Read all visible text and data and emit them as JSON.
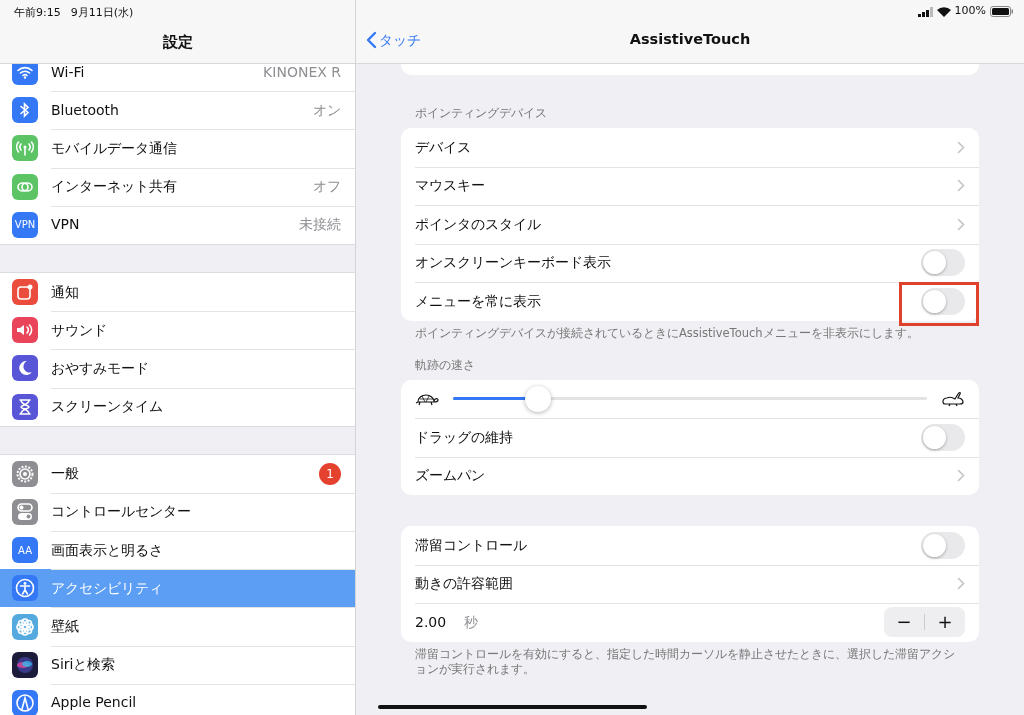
{
  "status_bar": {
    "time": "午前9:15",
    "date": "9月11日(水)",
    "battery": "100%"
  },
  "sidebar": {
    "title": "設定",
    "groups": [
      [
        {
          "label": "Wi-Fi",
          "value": "KINONEX R",
          "color": "#3478f6",
          "selected": false
        },
        {
          "label": "Bluetooth",
          "value": "オン",
          "color": "#3478f6",
          "selected": false
        },
        {
          "label": "モバイルデータ通信",
          "color": "#5dc466",
          "selected": false
        },
        {
          "label": "インターネット共有",
          "value": "オフ",
          "color": "#5dc466",
          "selected": false
        },
        {
          "label": "VPN",
          "value": "未接続",
          "color": "#3478f6",
          "icon_text": "VPN",
          "selected": false
        }
      ],
      [
        {
          "label": "通知",
          "color": "#ea4d3d",
          "selected": false
        },
        {
          "label": "サウンド",
          "color": "#e9445a",
          "selected": false
        },
        {
          "label": "おやすみモード",
          "color": "#5856d6",
          "selected": false
        },
        {
          "label": "スクリーンタイム",
          "color": "#5856d6",
          "selected": false
        }
      ],
      [
        {
          "label": "一般",
          "color": "#8e8e93",
          "badge": "1",
          "selected": false
        },
        {
          "label": "コントロールセンター",
          "color": "#8e8e93",
          "selected": false
        },
        {
          "label": "画面表示と明るさ",
          "color": "#3478f6",
          "icon_text": "AA",
          "selected": false
        },
        {
          "label": "アクセシビリティ",
          "color": "#3478f6",
          "selected": true
        },
        {
          "label": "壁紙",
          "color": "#54aadf",
          "selected": false
        },
        {
          "label": "Siriと検索",
          "color": "#1c1c3a",
          "selected": false
        },
        {
          "label": "Apple Pencil",
          "color": "#3478f6",
          "selected": false
        }
      ]
    ]
  },
  "detail": {
    "back": "タッチ",
    "title": "AssistiveTouch",
    "sections": [
      {
        "header": "ポインティングデバイス",
        "rows": [
          {
            "kind": "chevron",
            "label": "デバイス"
          },
          {
            "kind": "chevron",
            "label": "マウスキー"
          },
          {
            "kind": "chevron",
            "label": "ポインタのスタイル"
          },
          {
            "kind": "toggle",
            "label": "オンスクリーンキーボード表示",
            "on": false
          },
          {
            "kind": "toggle",
            "label": "メニューを常に表示",
            "on": false,
            "highlighted": true
          }
        ],
        "footer": "ポインティングデバイスが接続されているときにAssistiveTouchメニューを非表示にします。"
      },
      {
        "header": "軌跡の速さ",
        "rows": [
          {
            "kind": "slider",
            "level": 0.18
          },
          {
            "kind": "toggle",
            "label": "ドラッグの維持",
            "on": false
          },
          {
            "kind": "chevron",
            "label": "ズームパン"
          }
        ]
      },
      {
        "rows": [
          {
            "kind": "toggle",
            "label": "滞留コントロール",
            "on": false
          },
          {
            "kind": "chevron",
            "label": "動きの許容範囲"
          },
          {
            "kind": "stepper",
            "label": "2.00",
            "unit": "秒",
            "minus": "−",
            "plus": "+"
          }
        ],
        "footer": "滞留コントロールを有効にすると、指定した時間カーソルを静止させたときに、選択した滞留アクションが実行されます。"
      }
    ]
  }
}
